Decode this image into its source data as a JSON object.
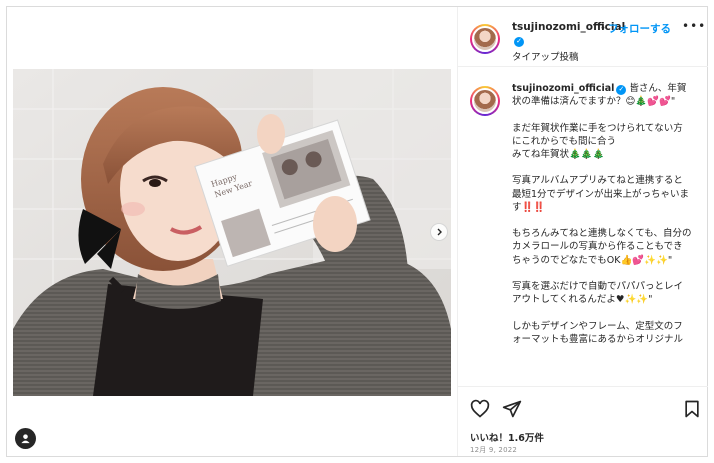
{
  "header": {
    "username": "tsujinozomi_official",
    "follow_label": "フォローする",
    "separator": "•",
    "more_label": "•••",
    "subtitle": "タイアップ投稿"
  },
  "caption": {
    "username": "tsujinozomi_official",
    "text": " 皆さん、年賀状の準備は済んでますか？😊🎄💕💕\"\n\nまだ年賀状作業に手をつけられてない方にこれからでも間に合う\nみてね年賀状🎄🎄🎄\n\n写真アルバムアプリみてねと連携すると最短1分でデザインが出来上がっちゃいます‼️‼️\n\nもちろんみてねと連携しなくても、自分のカメラロールの写真から作ることもできちゃうのでどなたでもOK👍💕✨✨\"\n\n写真を選ぶだけで自動でパパパっとレイアウトしてくれるんだよ♥✨✨\"\n\nしかもデザインやフレーム、定型文のフォーマットも豊富にあるからオリジナル"
  },
  "actions": {
    "likes": "いいね！1.6万件",
    "date": "12月 9, 2022"
  },
  "colors": {
    "accent": "#0095f6",
    "text": "#262626",
    "muted": "#8e8e8e",
    "border": "#dbdbdb"
  },
  "icons": {
    "verified": "verified-badge-icon",
    "like": "heart-icon",
    "share": "paper-plane-icon",
    "save": "bookmark-icon",
    "next": "chevron-right-icon",
    "tags": "user-tag-icon"
  }
}
